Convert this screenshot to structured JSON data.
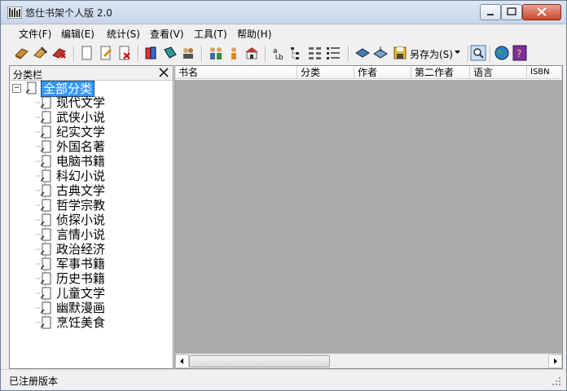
{
  "window": {
    "title": "悠仕书架个人版 2.0"
  },
  "menu": [
    "文件(F)",
    "编辑(E)",
    "统计(S)",
    "查看(V)",
    "工具(T)",
    "帮助(H)"
  ],
  "toolbar": {
    "saveas_label": "另存为(S)"
  },
  "sidebar": {
    "title": "分类栏",
    "root": "全部分类",
    "categories": [
      "现代文学",
      "武侠小说",
      "纪实文学",
      "外国名著",
      "电脑书籍",
      "科幻小说",
      "古典文学",
      "哲学宗教",
      "侦探小说",
      "言情小说",
      "政治经济",
      "军事书籍",
      "历史书籍",
      "儿童文学",
      "幽默漫画",
      "烹饪美食"
    ]
  },
  "table": {
    "columns": [
      "书名",
      "分类",
      "作者",
      "第二作者",
      "语言",
      "ISBN"
    ]
  },
  "status": {
    "text": "已注册版本"
  },
  "colors": {
    "selection": "#3399ff",
    "grid_background": "#ababab"
  }
}
